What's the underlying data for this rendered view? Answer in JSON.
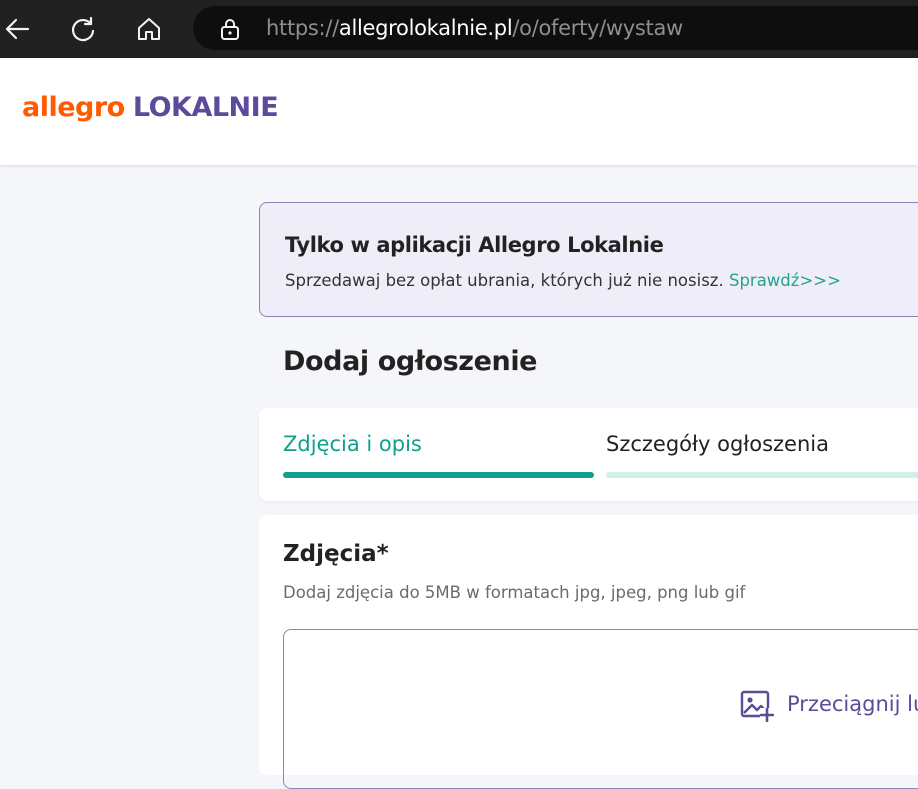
{
  "browser": {
    "url_prefix": "https://",
    "url_host": "allegrolokalnie.pl",
    "url_path": "/o/oferty/wystaw"
  },
  "header": {
    "logo_allegro": "allegro",
    "logo_lokalnie": "LOKALNIE"
  },
  "promo": {
    "title": "Tylko w aplikacji Allegro Lokalnie",
    "text": "Sprzedawaj bez opłat ubrania, których już nie nosisz.",
    "link": "Sprawdź>>>"
  },
  "page": {
    "title": "Dodaj ogłoszenie"
  },
  "steps": [
    {
      "label": "Zdjęcia i opis",
      "active": true
    },
    {
      "label": "Szczegóły ogłoszenia",
      "active": false
    }
  ],
  "photos": {
    "title": "Zdjęcia*",
    "hint": "Dodaj zdjęcia do 5MB w formatach jpg, jpeg, png lub gif",
    "dropzone_text": "Przeciągnij lub"
  },
  "colors": {
    "accent": "#10a08c",
    "brand_orange": "#ff5a00",
    "brand_purple": "#5c4a9a"
  }
}
